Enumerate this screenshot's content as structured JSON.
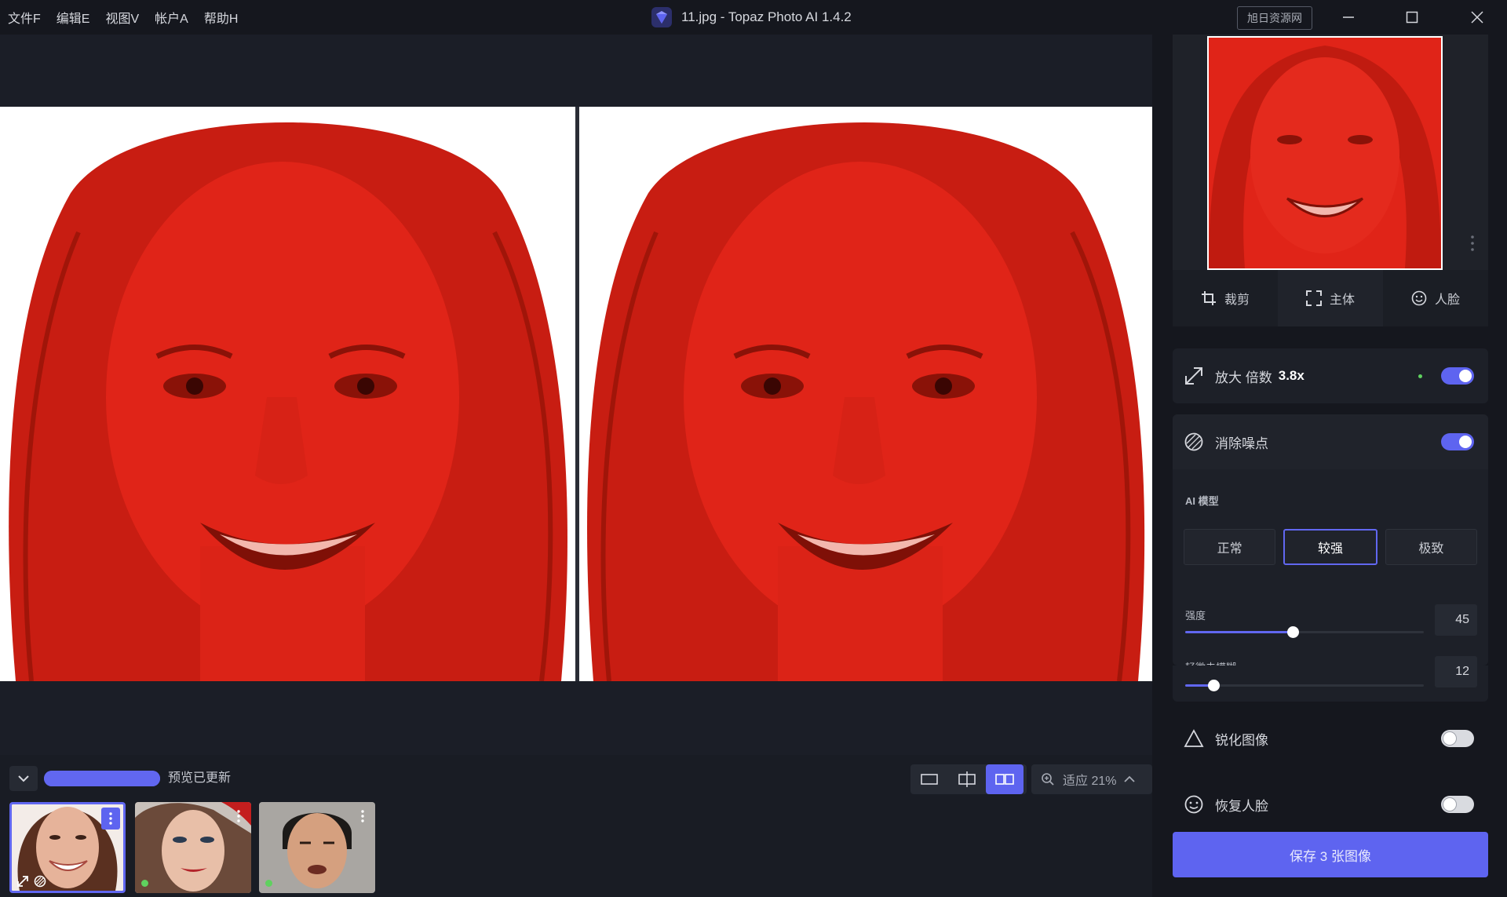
{
  "menu": {
    "items": [
      "文件F",
      "编辑E",
      "视图V",
      "帐户A",
      "帮助H"
    ]
  },
  "window": {
    "title": "11.jpg - Topaz Photo AI 1.4.2",
    "watermark_button": "旭日资源网",
    "icons": {
      "minimize": "minimize-icon",
      "maximize": "maximize-icon",
      "close": "close-icon"
    }
  },
  "canvas": {
    "left_label": "original-photo",
    "right_label": "processed-photo",
    "tint_color": "#e02418"
  },
  "bottombar": {
    "progress_fraction": 1.0,
    "progress_label": "预览已更新",
    "zoom_label": "适应 21%",
    "view_modes": [
      "single-view",
      "split-view",
      "side-by-side-view"
    ],
    "active_view": "side-by-side-view"
  },
  "thumbnails": [
    {
      "name": "thumb-1",
      "active": true,
      "badges": [
        "upscale-icon",
        "denoise-icon"
      ]
    },
    {
      "name": "thumb-2",
      "active": false,
      "status": "ready"
    },
    {
      "name": "thumb-3",
      "active": false,
      "status": "ready"
    }
  ],
  "panel": {
    "tabs": [
      {
        "label": "裁剪",
        "icon": "crop-icon"
      },
      {
        "label": "主体",
        "icon": "subject-icon"
      },
      {
        "label": "人脸",
        "icon": "face-icon"
      }
    ],
    "upscale": {
      "label": "放大 倍数",
      "value": "3.8x",
      "enabled": true
    },
    "denoise": {
      "label": "消除噪点",
      "enabled": true,
      "model_heading": "AI 模型",
      "models": [
        "正常",
        "较强",
        "极致"
      ],
      "selected_model": "较强",
      "strength": {
        "label": "强度",
        "value": "45",
        "fraction": 0.45
      },
      "deblur": {
        "label": "轻微去模糊",
        "value": "12",
        "fraction": 0.12
      }
    },
    "sharpen": {
      "label": "锐化图像",
      "enabled": false
    },
    "face_recovery": {
      "label": "恢复人脸",
      "enabled": false
    },
    "save_button": "保存 3 张图像"
  },
  "colors": {
    "accent": "#5e64f0",
    "status_green": "#5fd15f"
  }
}
